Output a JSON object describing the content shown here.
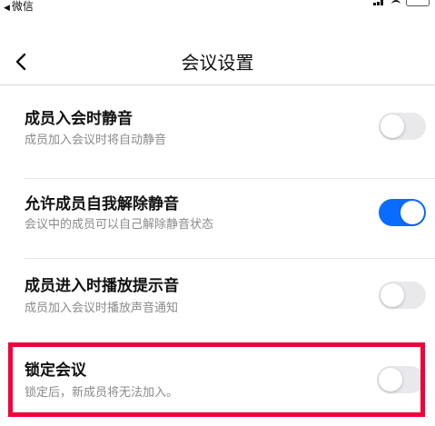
{
  "status_bar": {
    "back_app": "微信"
  },
  "nav": {
    "title": "会议设置",
    "back_icon": "chevron-left-icon"
  },
  "settings": [
    {
      "title": "成员入会时静音",
      "description": "成员加入会议时将自动静音",
      "enabled": false
    },
    {
      "title": "允许成员自我解除静音",
      "description": "会议中的成员可以自己解除静音状态",
      "enabled": true
    },
    {
      "title": "成员进入时播放提示音",
      "description": "成员加入会议时播放声音通知",
      "enabled": false
    },
    {
      "title": "锁定会议",
      "description": "锁定后，新成员将无法加入。",
      "enabled": false
    }
  ],
  "colors": {
    "toggle_on": "#0a6cff",
    "toggle_off": "#e9e9ec",
    "highlight": "#f0003c"
  }
}
